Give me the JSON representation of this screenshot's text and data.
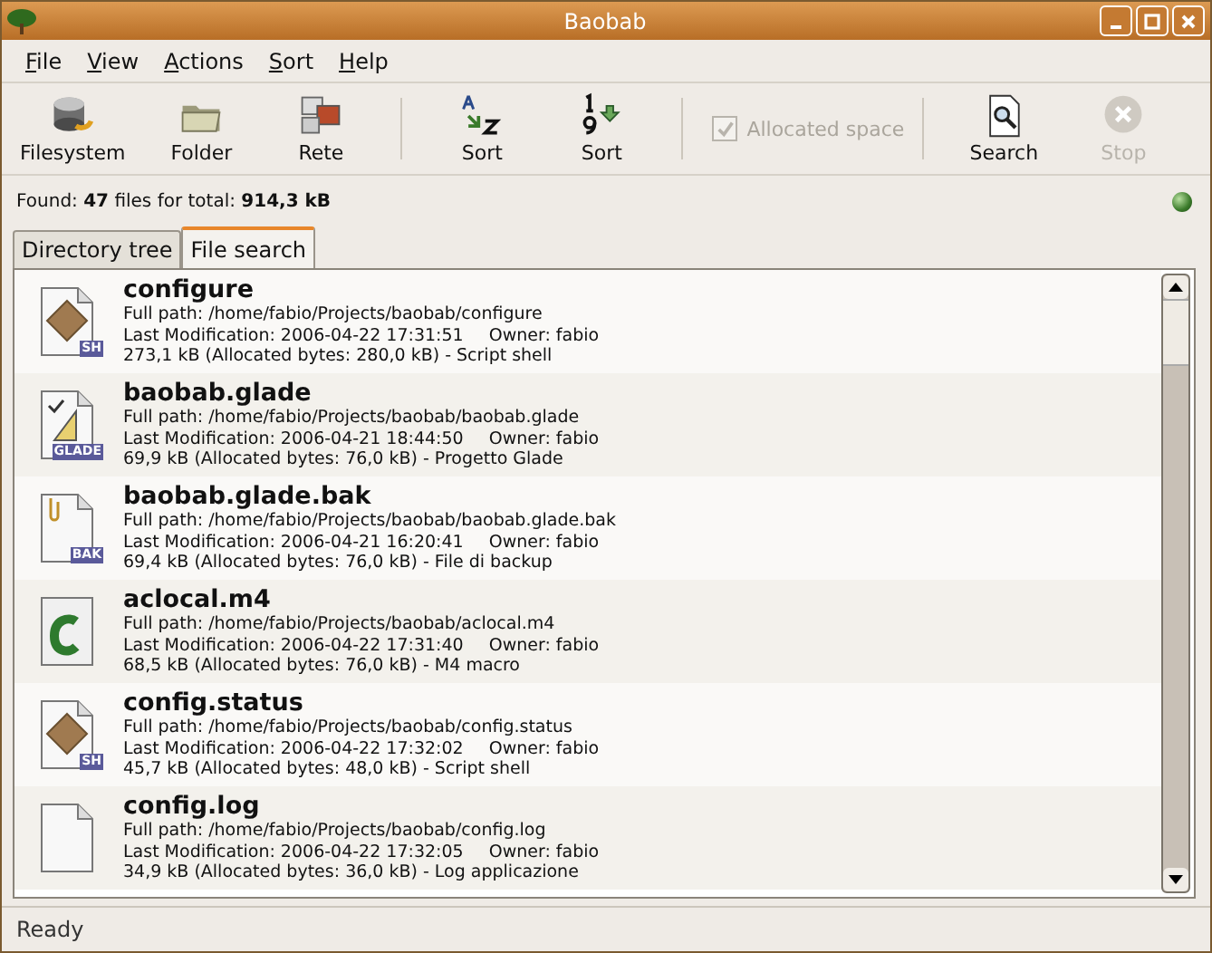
{
  "window": {
    "title": "Baobab"
  },
  "menu": [
    "File",
    "View",
    "Actions",
    "Sort",
    "Help"
  ],
  "toolbar": [
    {
      "kind": "button",
      "label": "Filesystem",
      "disabled": false
    },
    {
      "kind": "button",
      "label": "Folder",
      "disabled": false
    },
    {
      "kind": "button",
      "label": "Rete",
      "disabled": false
    },
    {
      "kind": "separator"
    },
    {
      "kind": "button",
      "label": "Sort",
      "disabled": false
    },
    {
      "kind": "button",
      "label": "Sort",
      "disabled": false
    },
    {
      "kind": "separator"
    },
    {
      "kind": "checkbox",
      "label": "Allocated space",
      "checked": true,
      "disabled": true
    },
    {
      "kind": "separator"
    },
    {
      "kind": "button",
      "label": "Search",
      "disabled": false
    },
    {
      "kind": "button",
      "label": "Stop",
      "disabled": true
    }
  ],
  "summary": "Found: **47** files for total: **914,3 kB**",
  "tabs": [
    {
      "label": "Directory tree",
      "selected": false
    },
    {
      "label": "File search",
      "selected": true
    }
  ],
  "files": [
    {
      "kind": "shell",
      "badge": "SH",
      "name": "configure",
      "path": "Full path: /home/fabio/Projects/baobab/configure",
      "modified": "Last Modification: 2006-04-22 17:31:51",
      "owner": "Owner: fabio",
      "size": "273,1 kB (Allocated bytes: 280,0 kB) - Script shell"
    },
    {
      "kind": "glade",
      "badge": "GLADE",
      "name": "baobab.glade",
      "path": "Full path: /home/fabio/Projects/baobab/baobab.glade",
      "modified": "Last Modification: 2006-04-21 18:44:50",
      "owner": "Owner: fabio",
      "size": "69,9 kB (Allocated bytes: 76,0 kB) - Progetto Glade"
    },
    {
      "kind": "backup",
      "badge": "BAK",
      "name": "baobab.glade.bak",
      "path": "Full path: /home/fabio/Projects/baobab/baobab.glade.bak",
      "modified": "Last Modification: 2006-04-21 16:20:41",
      "owner": "Owner: fabio",
      "size": "69,4 kB (Allocated bytes: 76,0 kB) - File di backup"
    },
    {
      "kind": "m4",
      "name": "aclocal.m4",
      "path": "Full path: /home/fabio/Projects/baobab/aclocal.m4",
      "modified": "Last Modification: 2006-04-22 17:31:40",
      "owner": "Owner: fabio",
      "size": "68,5 kB (Allocated bytes: 76,0 kB) - M4 macro"
    },
    {
      "kind": "shell",
      "badge": "SH",
      "name": "config.status",
      "path": "Full path: /home/fabio/Projects/baobab/config.status",
      "modified": "Last Modification: 2006-04-22 17:32:02",
      "owner": "Owner: fabio",
      "size": "45,7 kB (Allocated bytes: 48,0 kB) - Script shell"
    },
    {
      "kind": "text",
      "name": "config.log",
      "path": "Full path: /home/fabio/Projects/baobab/config.log",
      "modified": "Last Modification: 2006-04-22 17:32:05",
      "owner": "Owner: fabio",
      "size": "34,9 kB (Allocated bytes: 36,0 kB) - Log applicazione"
    }
  ],
  "status_bar": "Ready"
}
